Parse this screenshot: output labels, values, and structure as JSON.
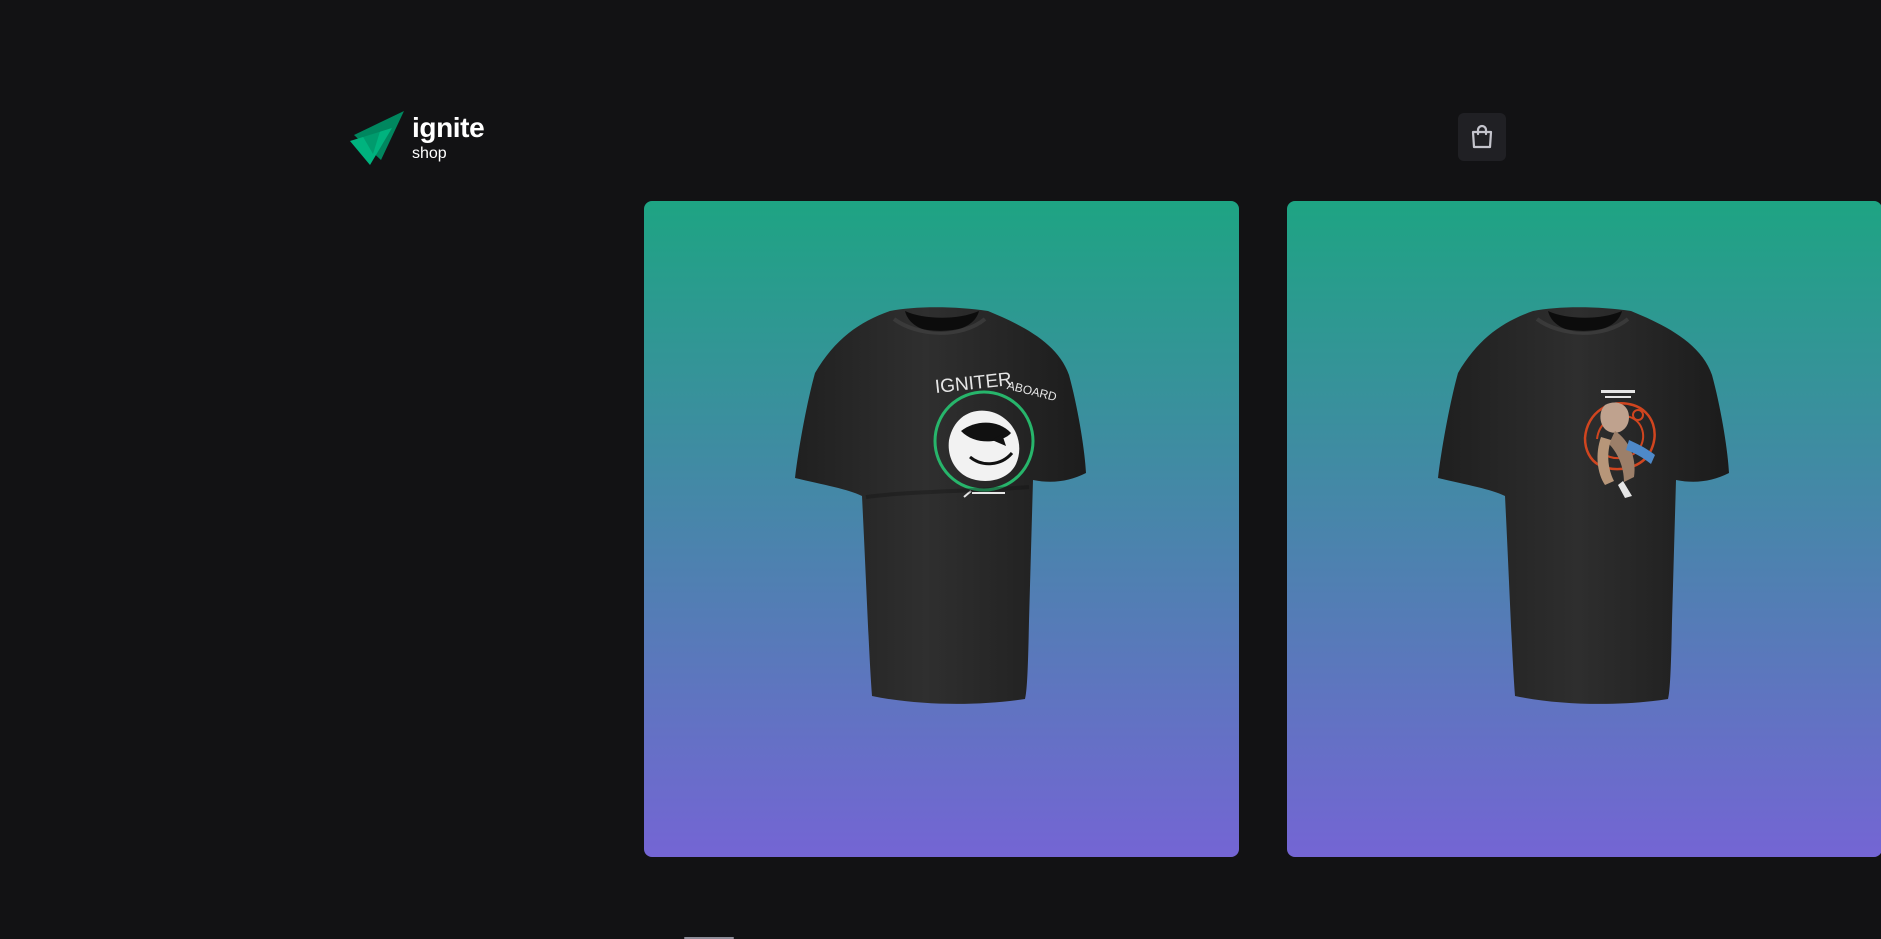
{
  "header": {
    "logo": {
      "title": "ignite",
      "subtitle": "shop",
      "colors": {
        "dark_green": "#00875f",
        "light_green": "#00b37e"
      }
    },
    "cart": {
      "icon": "shopping-bag-icon"
    }
  },
  "theme": {
    "background": "#121214",
    "cart_background": "#202024",
    "product_gradient_top": "#1ea483",
    "product_gradient_bottom": "#7465d4"
  },
  "products": [
    {
      "image": "black t-shirt with IGNITER ABOARD astronaut helmet print",
      "print_text": "IGNITER ABOARD"
    },
    {
      "image": "black t-shirt with astronaut and orbit print"
    }
  ]
}
